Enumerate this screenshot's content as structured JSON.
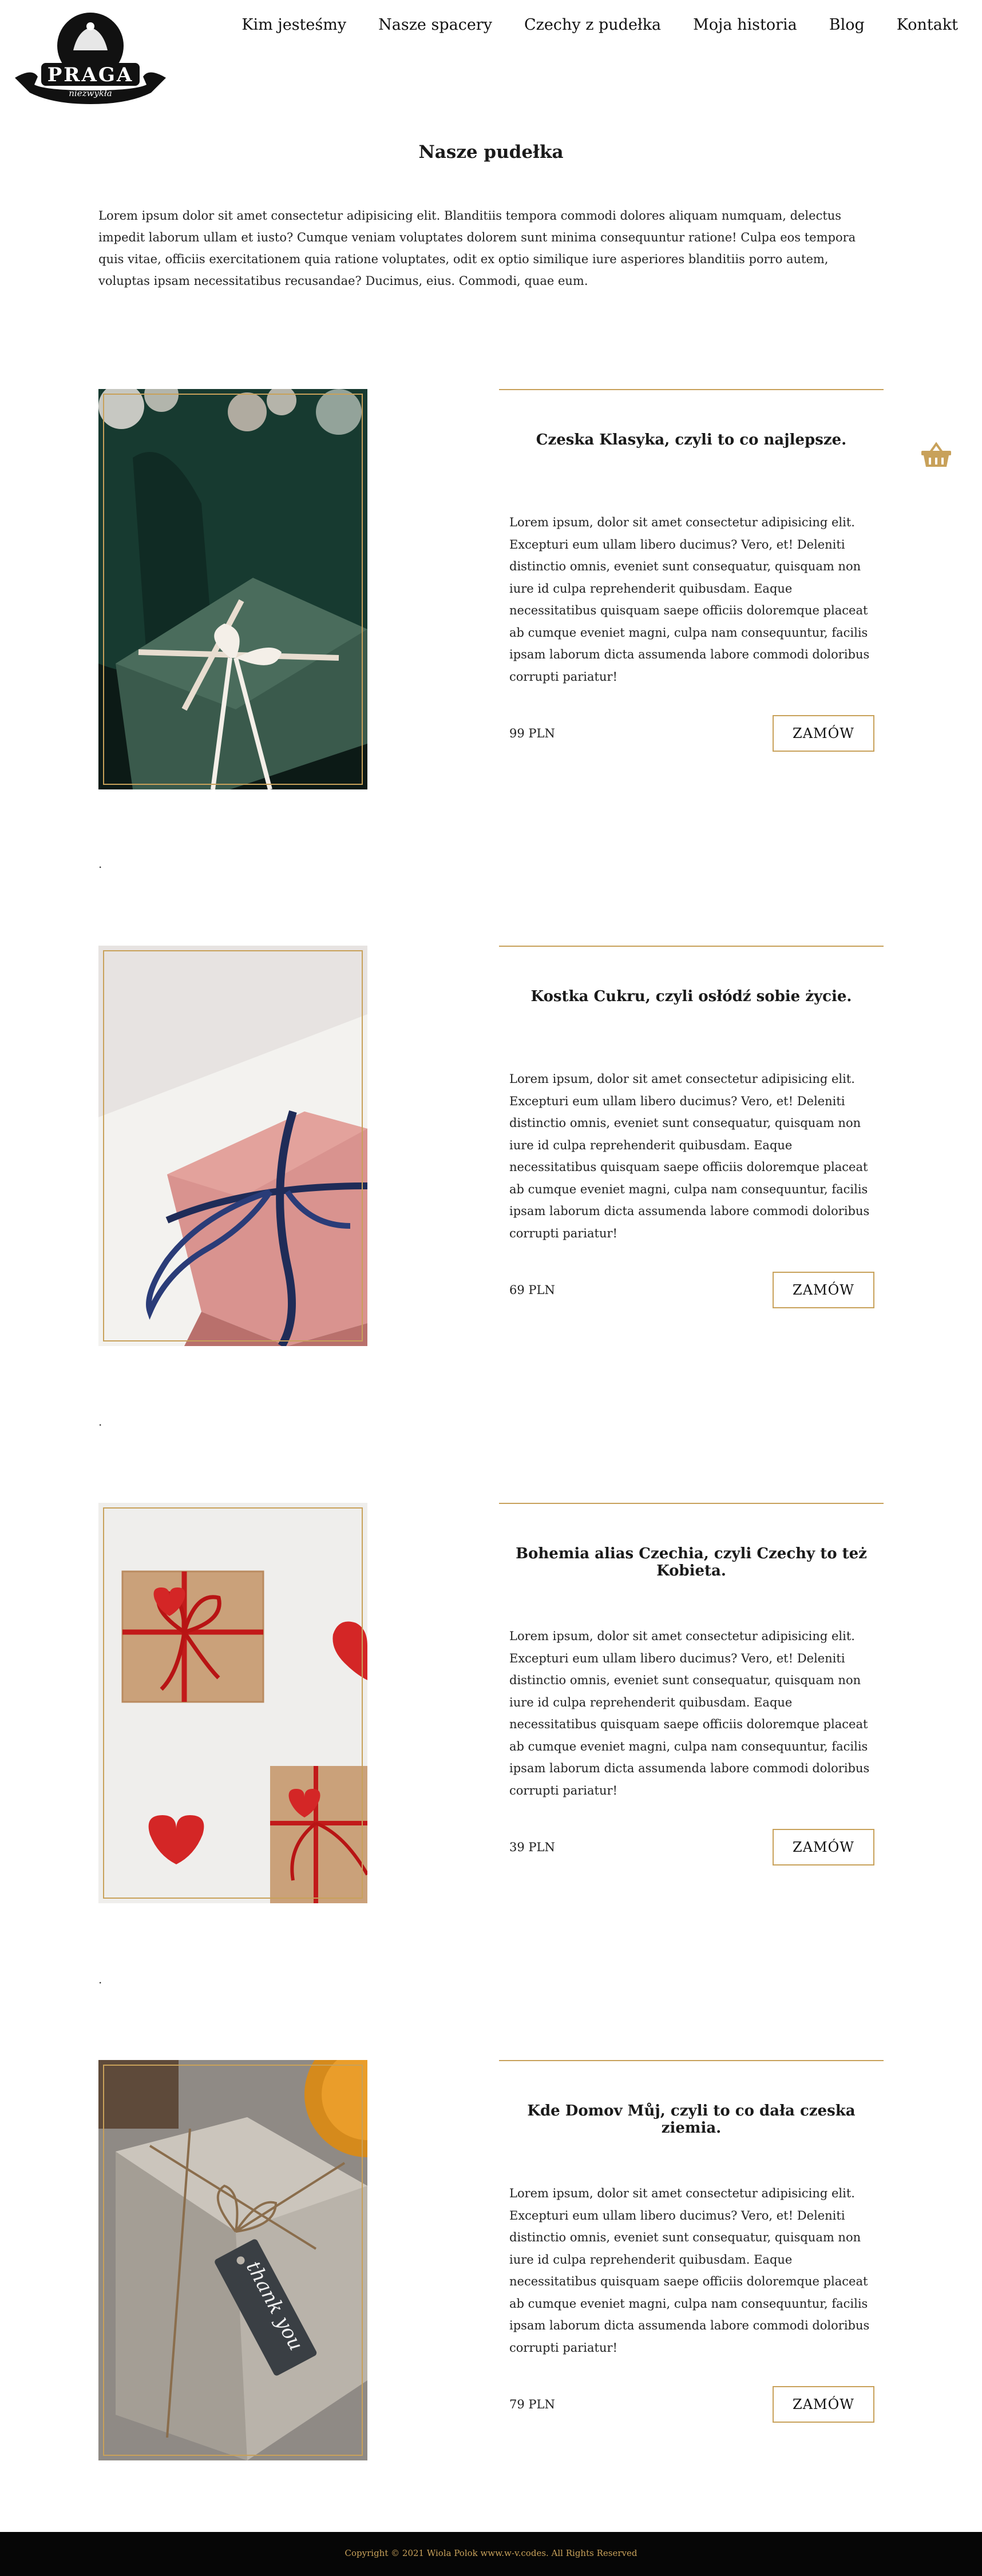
{
  "header": {
    "logo": {
      "title": "PRAGA",
      "subtitle": "niezwykła"
    },
    "nav": [
      "Kim jesteśmy",
      "Nasze spacery",
      "Czechy z pudełka",
      "Moja historia",
      "Blog",
      "Kontakt"
    ]
  },
  "basket_icon": "basket-icon",
  "page": {
    "title": "Nasze pudełka",
    "intro": "Lorem ipsum dolor sit amet consectetur adipisicing elit. Blanditiis tempora commodi dolores aliquam numquam, delectus impedit laborum ullam et iusto? Cumque veniam voluptates dolorem sunt minima consequuntur ratione! Culpa eos tempora quis vitae, officiis exercitationem quia ratione voluptates, odit ex optio similique iure asperiores blanditiis porro autem, voluptas ipsam necessitatibus recusandae? Ducimus, eius. Commodi, quae eum."
  },
  "products": [
    {
      "title": "Czeska Klasyka, czyli to co najlepsze.",
      "description": "Lorem ipsum, dolor sit amet consectetur adipisicing elit. Excepturi eum ullam libero ducimus? Vero, et! Deleniti distinctio omnis, eveniet sunt consequatur, quisquam non iure id culpa reprehenderit quibusdam. Eaque necessitatibus quisquam saepe officiis doloremque placeat ab cumque eveniet magni, culpa nam consequuntur, facilis ipsam laborum dicta assumenda labore commodi doloribus corrupti pariatur!",
      "price": "99 PLN",
      "button": "ZAMÓW",
      "separator": "."
    },
    {
      "title": "Kostka Cukru, czyli osłódź sobie życie.",
      "description": "Lorem ipsum, dolor sit amet consectetur adipisicing elit. Excepturi eum ullam libero ducimus? Vero, et! Deleniti distinctio omnis, eveniet sunt consequatur, quisquam non iure id culpa reprehenderit quibusdam. Eaque necessitatibus quisquam saepe officiis doloremque placeat ab cumque eveniet magni, culpa nam consequuntur, facilis ipsam laborum dicta assumenda labore commodi doloribus corrupti pariatur!",
      "price": "69 PLN",
      "button": "ZAMÓW",
      "separator": "."
    },
    {
      "title": "Bohemia alias Czechia, czyli Czechy to też Kobieta.",
      "description": "Lorem ipsum, dolor sit amet consectetur adipisicing elit. Excepturi eum ullam libero ducimus? Vero, et! Deleniti distinctio omnis, eveniet sunt consequatur, quisquam non iure id culpa reprehenderit quibusdam. Eaque necessitatibus quisquam saepe officiis doloremque placeat ab cumque eveniet magni, culpa nam consequuntur, facilis ipsam laborum dicta assumenda labore commodi doloribus corrupti pariatur!",
      "price": "39 PLN",
      "button": "ZAMÓW",
      "separator": "."
    },
    {
      "title": "Kde Domov Můj, czyli to co dała czeska ziemia.",
      "description": "Lorem ipsum, dolor sit amet consectetur adipisicing elit. Excepturi eum ullam libero ducimus? Vero, et! Deleniti distinctio omnis, eveniet sunt consequatur, quisquam non iure id culpa reprehenderit quibusdam. Eaque necessitatibus quisquam saepe officiis doloremque placeat ab cumque eveniet magni, culpa nam consequuntur, facilis ipsam laborum dicta assumenda labore commodi doloribus corrupti pariatur!",
      "price": "79 PLN",
      "button": "ZAMÓW",
      "tag_text": "thank you"
    }
  ],
  "footer": {
    "copyright": "Copyright © 2021 Wiola Polok www.w-v.codes. All Rights Reserved"
  },
  "colors": {
    "accent": "#c8a15a",
    "footer_bg": "#060606",
    "text": "#1a1a1a"
  }
}
